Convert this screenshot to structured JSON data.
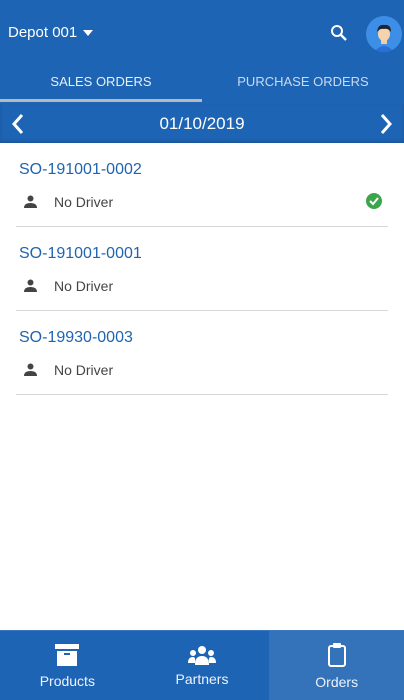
{
  "header": {
    "depot": "Depot 001",
    "icons": [
      "caret-down-icon",
      "search-icon",
      "avatar"
    ]
  },
  "tabs": [
    {
      "label": "SALES ORDERS",
      "active": true
    },
    {
      "label": "PURCHASE ORDERS",
      "active": false
    }
  ],
  "date_bar": {
    "date": "01/10/2019"
  },
  "orders": [
    {
      "code": "SO-191001-0002",
      "driver": "No Driver",
      "completed": true
    },
    {
      "code": "SO-191001-0001",
      "driver": "No Driver",
      "completed": false
    },
    {
      "code": "SO-19930-0003",
      "driver": "No Driver",
      "completed": false
    }
  ],
  "bottom_nav": [
    {
      "label": "Products",
      "icon": "archive-box-icon"
    },
    {
      "label": "Partners",
      "icon": "people-icon"
    },
    {
      "label": "Orders",
      "icon": "clipboard-icon",
      "active": true
    }
  ],
  "colors": {
    "primary": "#1e64b4",
    "link": "#2064b0",
    "success": "#3aa54a"
  }
}
